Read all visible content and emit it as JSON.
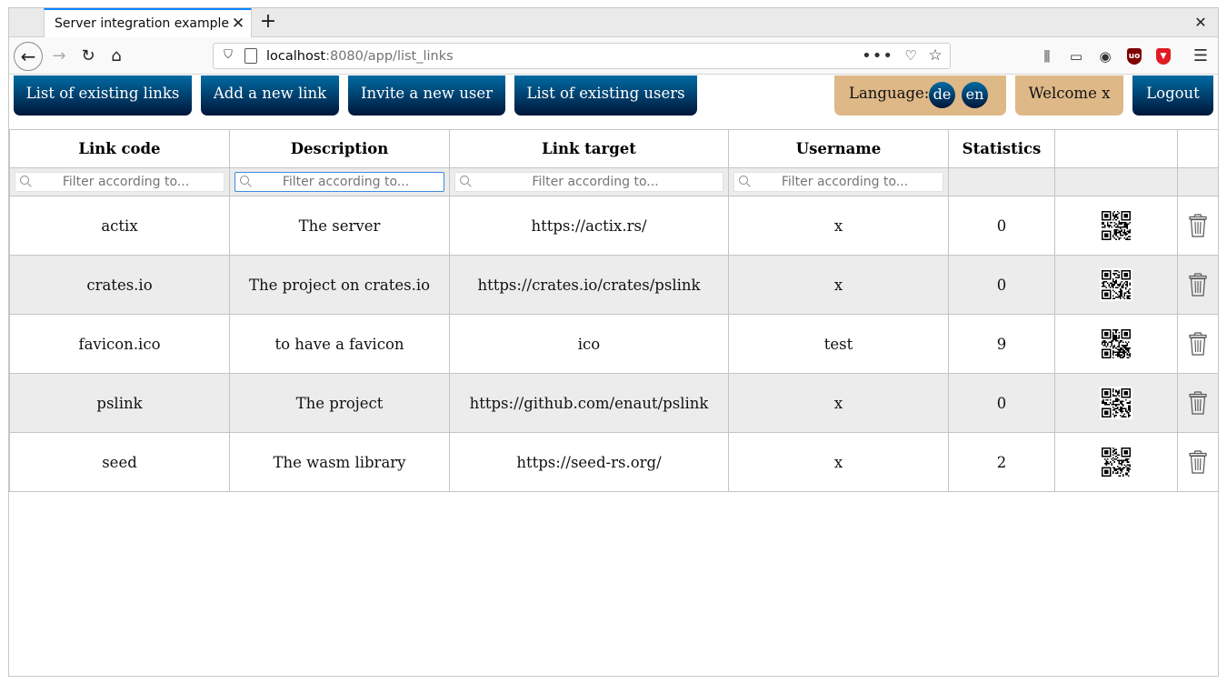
{
  "browser": {
    "tab_title": "Server integration example",
    "url_host": "localhost",
    "url_rest": ":8080/app/list_links"
  },
  "nav": {
    "list_links": "List of existing links",
    "add_link": "Add a new link",
    "invite_user": "Invite a new user",
    "list_users": "List of existing users",
    "language_label": "Language:",
    "lang_de": "de",
    "lang_en": "en",
    "welcome": "Welcome x",
    "logout": "Logout"
  },
  "table": {
    "headers": [
      "Link code",
      "Description",
      "Link target",
      "Username",
      "Statistics",
      "",
      ""
    ],
    "filter_placeholder": "Filter according to...",
    "rows": [
      {
        "code": "actix",
        "description": "The server",
        "target": "https://actix.rs/",
        "username": "x",
        "statistics": "0"
      },
      {
        "code": "crates.io",
        "description": "The project on crates.io",
        "target": "https://crates.io/crates/pslink",
        "username": "x",
        "statistics": "0"
      },
      {
        "code": "favicon.ico",
        "description": "to have a favicon",
        "target": "ico",
        "username": "test",
        "statistics": "9"
      },
      {
        "code": "pslink",
        "description": "The project",
        "target": "https://github.com/enaut/pslink",
        "username": "x",
        "statistics": "0"
      },
      {
        "code": "seed",
        "description": "The wasm library",
        "target": "https://seed-rs.org/",
        "username": "x",
        "statistics": "2"
      }
    ]
  },
  "colors": {
    "button_gradient_top": "#006ba3",
    "button_gradient_bottom": "#00163a",
    "accent_tan": "#deb887",
    "row_alt": "#ececec"
  }
}
